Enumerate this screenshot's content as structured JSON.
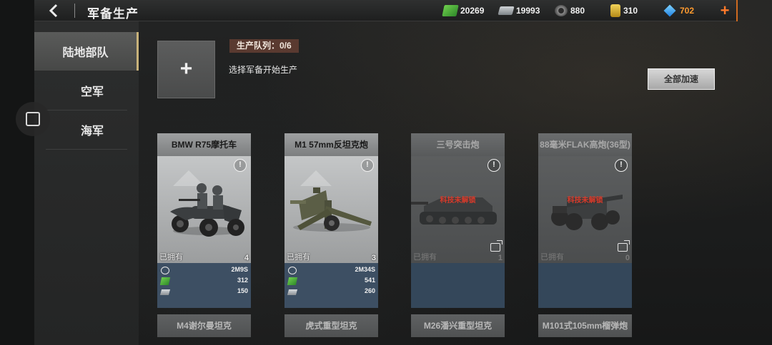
{
  "header": {
    "title": "军备生产",
    "back_icon": "back-arrow-icon"
  },
  "resources": [
    {
      "name": "cash",
      "icon": "cash-icon",
      "value": "20269"
    },
    {
      "name": "steel",
      "icon": "steel-icon",
      "value": "19993"
    },
    {
      "name": "rubber",
      "icon": "rubber-icon",
      "value": "880"
    },
    {
      "name": "gold",
      "icon": "gold-icon",
      "value": "310"
    },
    {
      "name": "diamond",
      "icon": "diamond-icon",
      "value": "702"
    }
  ],
  "add_resource_label": "+",
  "sidebar": {
    "items": [
      {
        "label": "陆地部队",
        "active": true
      },
      {
        "label": "空军",
        "active": false
      },
      {
        "label": "海军",
        "active": false
      }
    ]
  },
  "production": {
    "add_slot_label": "+",
    "queue_label": "生产队列：0/6",
    "hint": "选择军备开始生产",
    "speedup_label": "全部加速"
  },
  "cards": [
    {
      "name": "BMW R75摩托车",
      "owned_label": "已拥有",
      "owned": "4",
      "locked": false,
      "time": "2M9S",
      "cash": "312",
      "steel": "150"
    },
    {
      "name": "M1 57mm反坦克炮",
      "owned_label": "已拥有",
      "owned": "3",
      "locked": false,
      "time": "2M34S",
      "cash": "541",
      "steel": "260"
    },
    {
      "name": "三号突击炮",
      "owned_label": "已拥有",
      "owned": "1",
      "locked": true,
      "lock_text": "科技未解锁"
    },
    {
      "name": "88毫米FLAK高炮(36型)",
      "owned_label": "已拥有",
      "owned": "0",
      "locked": true,
      "lock_text": "科技未解锁"
    }
  ],
  "cards_row2": [
    {
      "name": "M4谢尔曼坦克"
    },
    {
      "name": "虎式重型坦克"
    },
    {
      "name": "M26潘兴重型坦克"
    },
    {
      "name": "M101式105mm榴弹炮"
    }
  ],
  "colors": {
    "accent_orange": "#ff7a2a",
    "active_tab_border": "#c8b27a",
    "lock_red": "#d83a2a",
    "stats_panel": "#3d4f63"
  }
}
